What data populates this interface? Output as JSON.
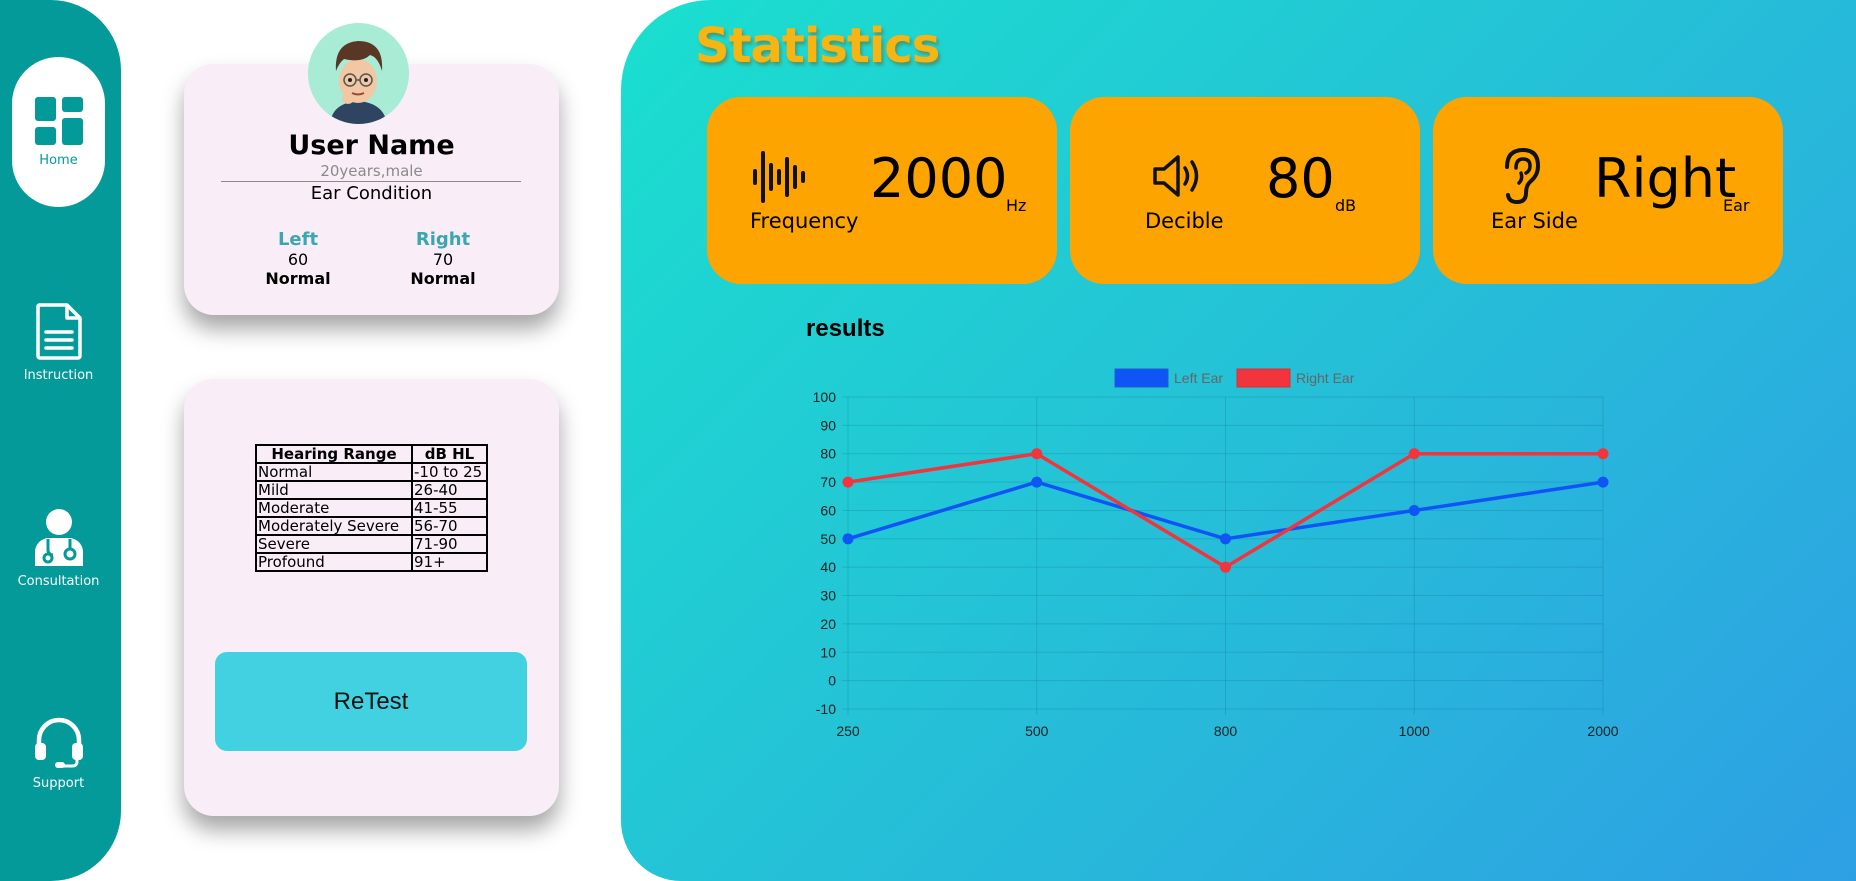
{
  "sidebar": {
    "items": [
      {
        "label": "Home",
        "icon": "dashboard-icon"
      },
      {
        "label": "Instruction",
        "icon": "document-icon"
      },
      {
        "label": "Consultation",
        "icon": "doctor-icon"
      },
      {
        "label": "Support",
        "icon": "headset-icon"
      }
    ]
  },
  "profile": {
    "name": "User Name",
    "subtitle": "20years,male",
    "ear_condition_label": "Ear Condition",
    "left": {
      "label": "Left",
      "value": "60",
      "condition": "Normal"
    },
    "right": {
      "label": "Right",
      "value": "70",
      "condition": "Normal"
    }
  },
  "hearing_table": {
    "headers": [
      "Hearing Range",
      "dB HL"
    ],
    "rows": [
      [
        "Normal",
        "-10 to 25"
      ],
      [
        "Mild",
        "26-40"
      ],
      [
        "Moderate",
        "41-55"
      ],
      [
        "Moderately Severe",
        "56-70"
      ],
      [
        "Severe",
        "71-90"
      ],
      [
        "Profound",
        "91+"
      ]
    ]
  },
  "retest_label": "ReTest",
  "stats": {
    "title": "Statistics",
    "cards": [
      {
        "label": "Frequency",
        "value": "2000",
        "unit": "Hz",
        "icon": "sound-wave-icon"
      },
      {
        "label": "Decible",
        "value": "80",
        "unit": "dB",
        "icon": "speaker-icon"
      },
      {
        "label": "Ear Side",
        "value": "Right",
        "unit": "Ear",
        "icon": "ear-icon"
      }
    ]
  },
  "results_title": "results",
  "colors": {
    "sidebar": "#059a9a",
    "card_bg": "#f9eef7",
    "stat_card": "#fea400",
    "title": "#f6b512",
    "left_ear": "#0f55f5",
    "right_ear": "#f2343c",
    "retest_button": "#42d1e0"
  },
  "chart_data": {
    "type": "line",
    "x": [
      "250",
      "500",
      "800",
      "1000",
      "2000"
    ],
    "series": [
      {
        "name": "Left Ear",
        "values": [
          50,
          70,
          50,
          60,
          70
        ],
        "color": "#0f55f5"
      },
      {
        "name": "Right Ear",
        "values": [
          70,
          80,
          40,
          80,
          80
        ],
        "color": "#f2343c"
      }
    ],
    "ylim": [
      -10,
      100
    ],
    "yticks": [
      "100",
      "90",
      "80",
      "70",
      "60",
      "50",
      "40",
      "30",
      "20",
      "10",
      "0",
      "-10"
    ],
    "grid": true,
    "legend": "top-center"
  }
}
